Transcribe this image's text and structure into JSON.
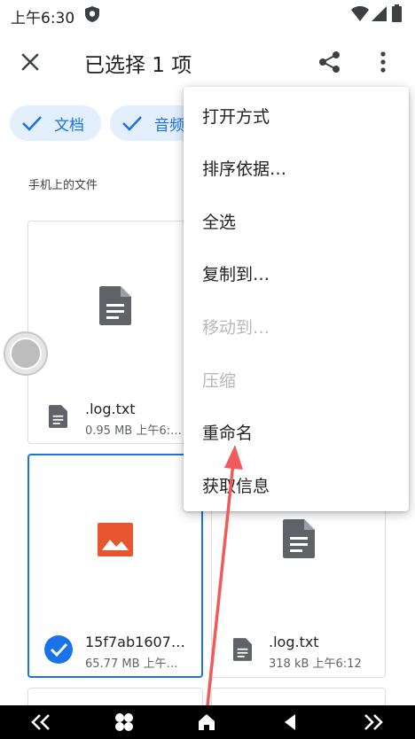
{
  "status_bar": {
    "time": "上午6:30",
    "icons": [
      "shield-icon",
      "wifi-icon",
      "signal-icon",
      "battery-icon"
    ]
  },
  "app_bar": {
    "title": "已选择 1 项",
    "close_icon": "close-icon",
    "share_icon": "share-icon",
    "more_icon": "more-vert-icon"
  },
  "filters": {
    "chips": [
      {
        "label": "文档",
        "selected": true
      },
      {
        "label": "音频",
        "selected": true
      }
    ]
  },
  "section": {
    "label": "手机上的文件"
  },
  "files": [
    {
      "name": ".log.txt",
      "meta": "0.95 MB 上午6:…",
      "type": "document",
      "selected": false
    },
    {
      "name": "15f7ab1607…",
      "meta": "65.77 MB 上午…",
      "type": "image",
      "selected": true
    },
    {
      "name": ".log.txt",
      "meta": "318 kB 上午6:12",
      "type": "document",
      "selected": false
    }
  ],
  "menu": {
    "items": [
      {
        "label": "打开方式",
        "enabled": true
      },
      {
        "label": "排序依据…",
        "enabled": true
      },
      {
        "label": "全选",
        "enabled": true
      },
      {
        "label": "复制到…",
        "enabled": true
      },
      {
        "label": "移动到…",
        "enabled": false
      },
      {
        "label": "压缩",
        "enabled": false
      },
      {
        "label": "重命名",
        "enabled": true
      },
      {
        "label": "获取信息",
        "enabled": true
      }
    ]
  },
  "nav_bar": {
    "buttons": [
      "double-chevron-left-icon",
      "apps-icon",
      "home-icon",
      "back-icon",
      "double-chevron-right-icon"
    ]
  },
  "colors": {
    "accent": "#1a73e8",
    "chip_bg": "#e3effd",
    "doc_icon": "#5f6368",
    "image_icon": "#e8552f",
    "annotation_arrow": "#f05a5a",
    "nav_bg": "#000000"
  }
}
